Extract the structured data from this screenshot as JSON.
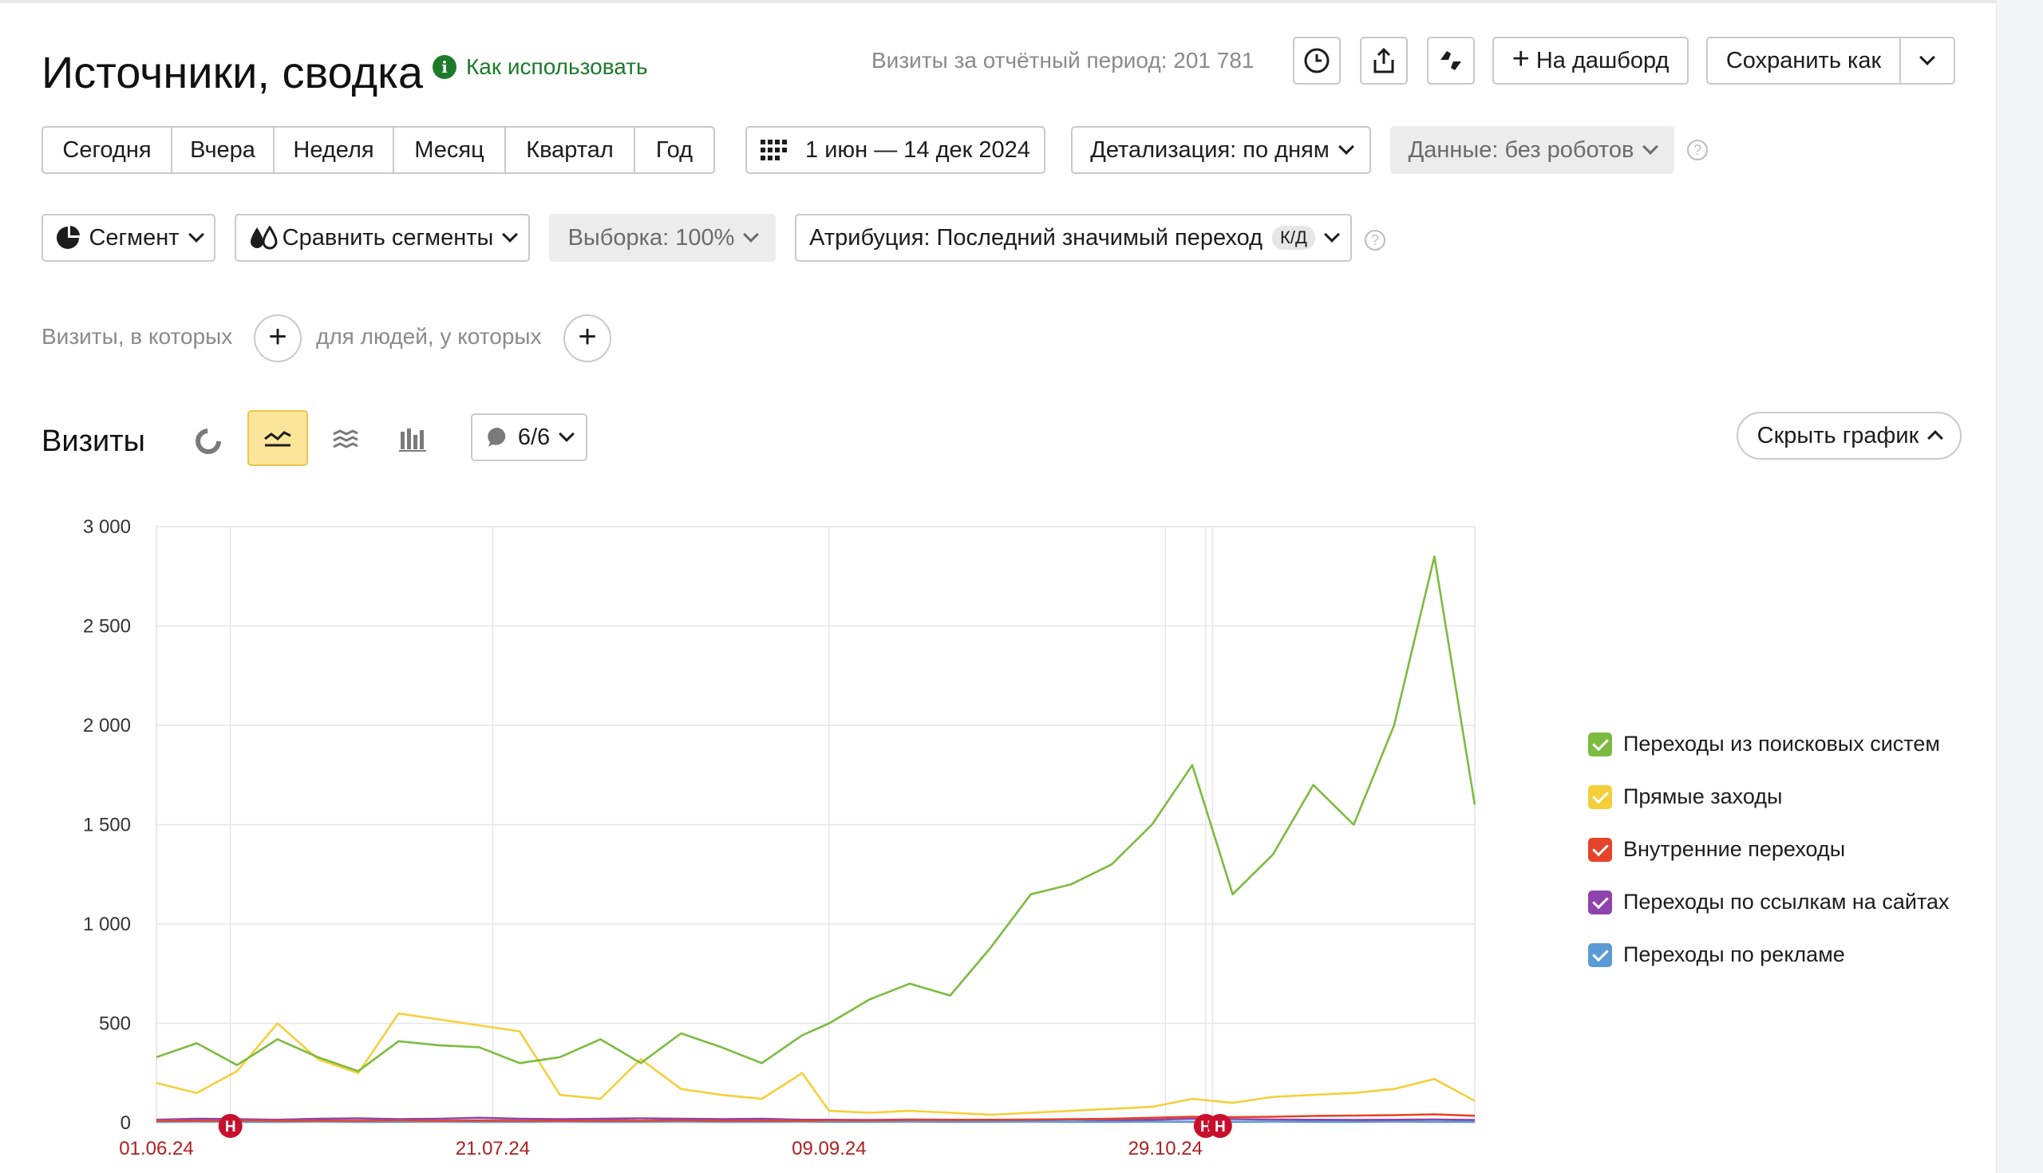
{
  "header": {
    "title": "Источники, сводка",
    "help_link": "Как использовать",
    "visits_summary": "Визиты за отчётный период: 201 781",
    "dashboard_button": "На дашборд",
    "save_button": "Сохранить как"
  },
  "period_tabs": [
    "Сегодня",
    "Вчера",
    "Неделя",
    "Месяц",
    "Квартал",
    "Год"
  ],
  "date_range": "1 июн — 14 дек 2024",
  "detail_select": "Детализация: по дням",
  "data_select": "Данные: без роботов",
  "filters": {
    "segment": "Сегмент",
    "compare": "Сравнить сегменты",
    "sample": "Выборка: 100%",
    "attribution": "Атрибуция: Последний значимый переход",
    "attribution_badge": "К/Д"
  },
  "conditions": {
    "visits_label": "Визиты, в которых",
    "people_label": "для людей, у которых"
  },
  "chart_section": {
    "title": "Визиты",
    "annotations_counter": "6/6",
    "hide_chart_button": "Скрыть график"
  },
  "colors": {
    "search": "#7cbb3f",
    "direct": "#f5cf3a",
    "internal": "#e5432a",
    "links": "#8e44ad",
    "ads": "#5b9bd5",
    "holiday_marker": "#c8102e"
  },
  "chart_data": {
    "type": "line",
    "x": [
      "2024-06-01",
      "2024-06-07",
      "2024-06-13",
      "2024-06-19",
      "2024-06-25",
      "2024-07-01",
      "2024-07-07",
      "2024-07-13",
      "2024-07-19",
      "2024-07-25",
      "2024-07-31",
      "2024-08-06",
      "2024-08-12",
      "2024-08-18",
      "2024-08-24",
      "2024-08-30",
      "2024-09-05",
      "2024-09-09",
      "2024-09-15",
      "2024-09-21",
      "2024-09-27",
      "2024-10-03",
      "2024-10-09",
      "2024-10-15",
      "2024-10-21",
      "2024-10-27",
      "2024-11-02",
      "2024-11-08",
      "2024-11-14",
      "2024-11-20",
      "2024-11-26",
      "2024-12-02",
      "2024-12-08",
      "2024-12-14"
    ],
    "x_tick_labels": [
      "01.06.24",
      "21.07.24",
      "09.09.24",
      "29.10.24"
    ],
    "y_tick_labels": [
      "0",
      "500",
      "1 000",
      "1 500",
      "2 000",
      "2 500",
      "3 000"
    ],
    "ylim": [
      0,
      3000
    ],
    "series": [
      {
        "name": "Переходы из поисковых систем",
        "color": "#7cbb3f",
        "values": [
          330,
          400,
          290,
          420,
          330,
          260,
          410,
          390,
          380,
          300,
          330,
          420,
          300,
          450,
          380,
          300,
          440,
          500,
          620,
          700,
          640,
          880,
          1150,
          1200,
          1300,
          1500,
          1800,
          1150,
          1350,
          1700,
          1500,
          2000,
          2850,
          1600
        ]
      },
      {
        "name": "Прямые заходы",
        "color": "#f5cf3a",
        "values": [
          200,
          150,
          260,
          500,
          320,
          250,
          550,
          520,
          490,
          460,
          140,
          120,
          320,
          170,
          140,
          120,
          250,
          60,
          50,
          60,
          50,
          40,
          50,
          60,
          70,
          80,
          120,
          100,
          130,
          140,
          150,
          170,
          220,
          110
        ]
      },
      {
        "name": "Внутренние переходы",
        "color": "#e5432a",
        "values": [
          10,
          10,
          12,
          10,
          11,
          10,
          12,
          10,
          11,
          10,
          10,
          11,
          10,
          12,
          10,
          11,
          10,
          12,
          12,
          14,
          14,
          15,
          16,
          18,
          20,
          25,
          30,
          28,
          30,
          34,
          36,
          38,
          42,
          35
        ]
      },
      {
        "name": "Переходы по ссылкам на сайтах",
        "color": "#8e44ad",
        "values": [
          15,
          20,
          18,
          15,
          20,
          22,
          18,
          20,
          25,
          20,
          18,
          20,
          22,
          20,
          18,
          20,
          15,
          15,
          14,
          16,
          15,
          14,
          15,
          16,
          14,
          15,
          20,
          18,
          16,
          15,
          14,
          15,
          16,
          14
        ]
      },
      {
        "name": "Переходы по рекламе",
        "color": "#5b9bd5",
        "values": [
          5,
          6,
          5,
          5,
          6,
          5,
          5,
          6,
          5,
          5,
          6,
          5,
          5,
          6,
          5,
          5,
          6,
          5,
          5,
          6,
          5,
          5,
          6,
          5,
          5,
          6,
          5,
          5,
          6,
          5,
          5,
          6,
          5,
          5
        ]
      }
    ],
    "holiday_markers": [
      {
        "x": "2024-06-12",
        "label": "Н"
      },
      {
        "x": "2024-11-04",
        "label": "Н"
      },
      {
        "x": "2024-11-04",
        "label": "Н"
      }
    ],
    "legend_position": "right",
    "grid": true
  }
}
